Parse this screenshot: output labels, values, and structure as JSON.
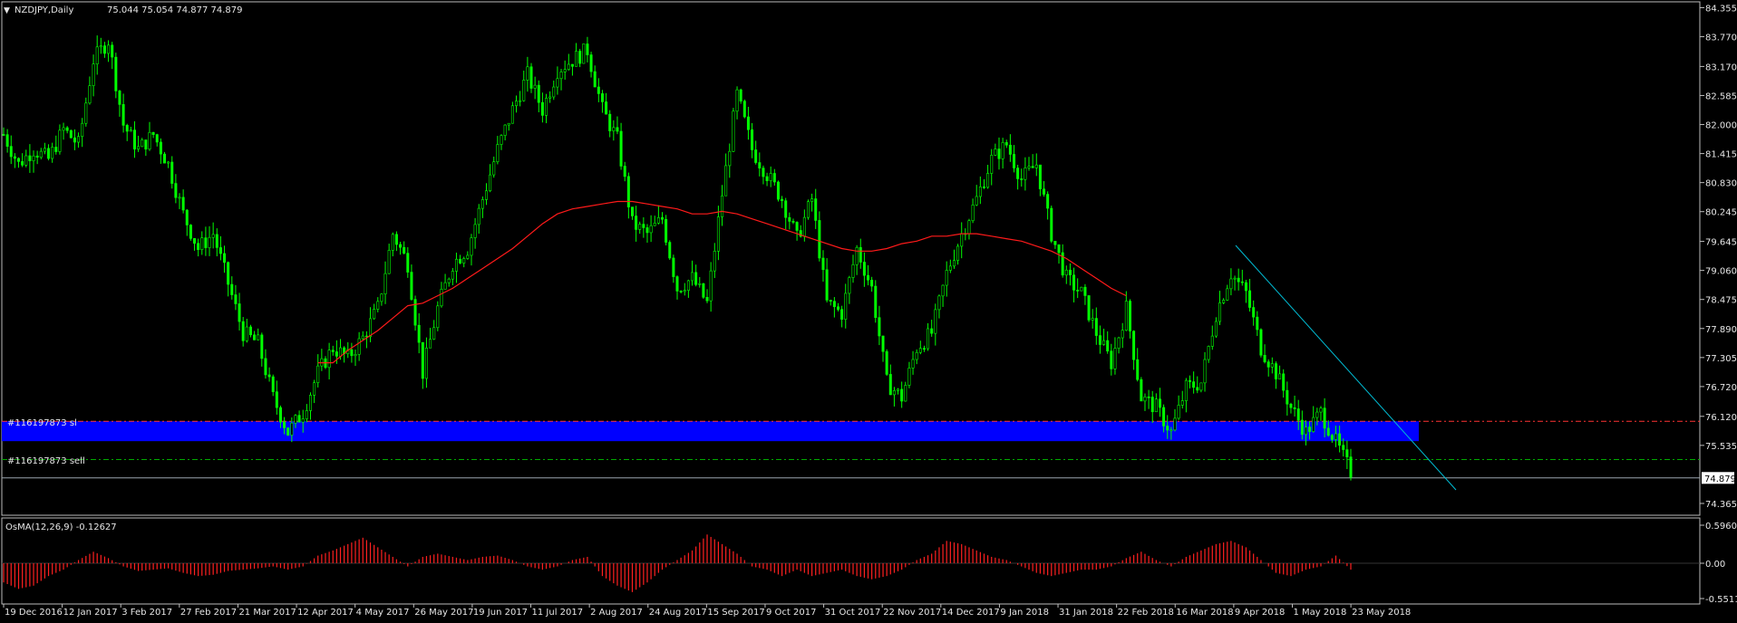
{
  "header": {
    "symbol_timeframe": "NZDJPY,Daily",
    "ohlc": "75.044 75.054 74.877 74.879"
  },
  "indicator": {
    "label": "OsMA(12,26,9) -0.12627",
    "scale": [
      "0.59601",
      "0.00",
      "-0.55112"
    ]
  },
  "orders": {
    "sl_label": "#116197873 sl",
    "sell_label": "#116197873 sell",
    "sl_price": 76.02,
    "sell_price": 75.25
  },
  "current_price_label": "74.879",
  "colors": {
    "background": "#000000",
    "candle": "#00ff00",
    "moving_average": "#ff1a1a",
    "zone": "#0000ff",
    "trendline": "#00bcd4",
    "sl_line": "#ff3333",
    "sell_line": "#00aa00",
    "histogram": "#ff2020",
    "grid": "#ffffff"
  },
  "chart_data": [
    {
      "type": "line",
      "title": "NZDJPY,Daily",
      "x_ticks": [
        "19 Dec 2016",
        "12 Jan 2017",
        "3 Feb 2017",
        "27 Feb 2017",
        "21 Mar 2017",
        "12 Apr 2017",
        "4 May 2017",
        "26 May 2017",
        "19 Jun 2017",
        "11 Jul 2017",
        "2 Aug 2017",
        "24 Aug 2017",
        "15 Sep 2017",
        "9 Oct 2017",
        "31 Oct 2017",
        "22 Nov 2017",
        "14 Dec 2017",
        "9 Jan 2018",
        "31 Jan 2018",
        "22 Feb 2018",
        "16 Mar 2018",
        "9 Apr 2018",
        "1 May 2018",
        "23 May 2018"
      ],
      "y_ticks": [
        "84.355",
        "83.770",
        "83.170",
        "82.585",
        "82.000",
        "81.415",
        "80.830",
        "80.245",
        "79.645",
        "79.060",
        "78.475",
        "77.890",
        "77.305",
        "76.720",
        "76.120",
        "75.535",
        "74.879",
        "74.365"
      ],
      "ylim": [
        74.2,
        84.4
      ],
      "series": [
        {
          "values": [
            81.8,
            81.2,
            81.5,
            81.3,
            81.9,
            81.6,
            83.3,
            83.7,
            82.0,
            81.5,
            81.8,
            81.2,
            80.2,
            79.5,
            79.8,
            78.8,
            77.8,
            77.6,
            76.5,
            75.8,
            76.2,
            77.0,
            77.5,
            77.3,
            77.7,
            78.3,
            79.8,
            79.2,
            77.0,
            78.3,
            79.2,
            79.5,
            80.5,
            81.5,
            82.3,
            83.0,
            82.3,
            83.1,
            83.3,
            83.5,
            82.3,
            81.7,
            80.0,
            79.8,
            80.1,
            78.7,
            78.9,
            78.4,
            80.6,
            82.6,
            81.5,
            81.0,
            80.5,
            79.7,
            80.5,
            78.4,
            78.2,
            79.5,
            78.7,
            76.8,
            76.5,
            77.5,
            77.8,
            79.0,
            79.8,
            80.5,
            81.3,
            81.6,
            80.9,
            81.2,
            79.8,
            78.9,
            78.6,
            77.8,
            77.2,
            78.3,
            76.5,
            76.3,
            75.8,
            76.7,
            76.8,
            78.2,
            79.0,
            78.6,
            77.5,
            77.0,
            76.3,
            75.8,
            76.2,
            75.6,
            75.0
          ]
        },
        {
          "name": "",
          "values": [
            null,
            null,
            null,
            null,
            null,
            null,
            null,
            null,
            null,
            null,
            null,
            null,
            null,
            null,
            null,
            null,
            null,
            null,
            null,
            null,
            null,
            77.2,
            77.2,
            77.45,
            77.65,
            77.85,
            78.1,
            78.35,
            78.4,
            78.55,
            78.7,
            78.9,
            79.1,
            79.3,
            79.5,
            79.75,
            80.0,
            80.2,
            80.3,
            80.35,
            80.4,
            80.45,
            80.45,
            80.4,
            80.35,
            80.3,
            80.2,
            80.2,
            80.25,
            80.2,
            80.1,
            80.0,
            79.9,
            79.8,
            79.7,
            79.6,
            79.5,
            79.45,
            79.45,
            79.5,
            79.6,
            79.65,
            79.75,
            79.75,
            79.8,
            79.8,
            79.75,
            79.7,
            79.65,
            79.55,
            79.45,
            79.3,
            79.1,
            78.9,
            78.7,
            78.55,
            null,
            null,
            null,
            null,
            null,
            null,
            null,
            null,
            null,
            null,
            null,
            null,
            null,
            null,
            null
          ]
        }
      ]
    },
    {
      "type": "bar",
      "title": "OsMA(12,26,9) -0.12627",
      "ylim": [
        -0.55112,
        0.59601
      ],
      "values": [
        -0.3,
        -0.4,
        -0.35,
        -0.2,
        -0.1,
        0.05,
        0.18,
        0.08,
        -0.05,
        -0.12,
        -0.1,
        -0.08,
        -0.15,
        -0.2,
        -0.18,
        -0.12,
        -0.1,
        -0.08,
        -0.05,
        -0.1,
        -0.05,
        0.12,
        0.2,
        0.3,
        0.4,
        0.25,
        0.1,
        -0.05,
        0.1,
        0.15,
        0.1,
        0.05,
        0.1,
        0.12,
        0.05,
        -0.05,
        -0.1,
        -0.05,
        0.05,
        0.1,
        -0.2,
        -0.35,
        -0.45,
        -0.3,
        -0.1,
        0.05,
        0.2,
        0.45,
        0.3,
        0.15,
        -0.05,
        -0.1,
        -0.2,
        -0.1,
        -0.2,
        -0.15,
        -0.1,
        -0.2,
        -0.25,
        -0.2,
        -0.1,
        0.05,
        0.15,
        0.35,
        0.3,
        0.2,
        0.1,
        0.05,
        -0.05,
        -0.15,
        -0.2,
        -0.15,
        -0.1,
        -0.1,
        -0.05,
        0.08,
        0.18,
        0.05,
        -0.05,
        0.1,
        0.2,
        0.3,
        0.35,
        0.25,
        0.05,
        -0.15,
        -0.2,
        -0.1,
        -0.05,
        0.12,
        -0.1
      ]
    }
  ]
}
